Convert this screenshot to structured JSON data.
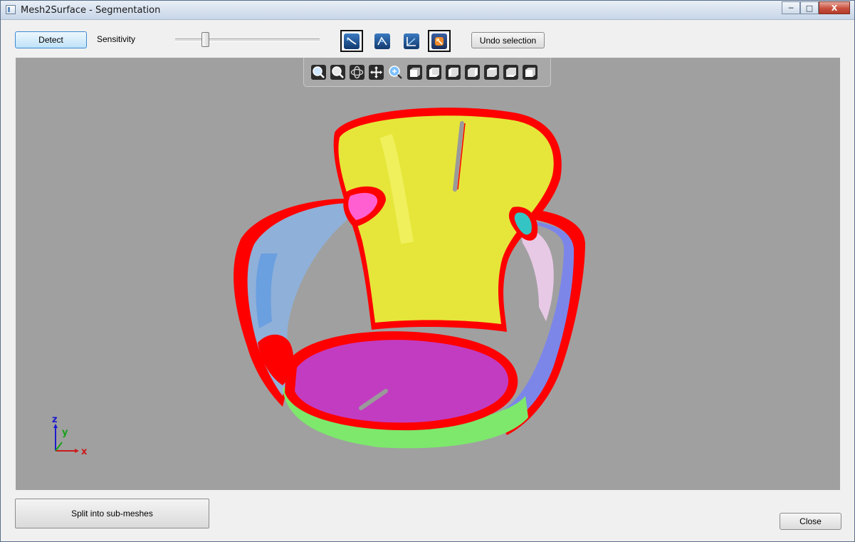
{
  "window": {
    "title": "Mesh2Surface - Segmentation",
    "controls": {
      "minimize": "─",
      "maximize": "□",
      "close": "X"
    }
  },
  "toolbar": {
    "detect_label": "Detect",
    "sensitivity_label": "Sensitivity",
    "sensitivity_level": 0.2,
    "undo_label": "Undo selection",
    "mode_buttons": [
      {
        "name": "select-region-tool",
        "active": true
      },
      {
        "name": "select-edge-tool",
        "active": false
      },
      {
        "name": "select-angle-tool",
        "active": false
      },
      {
        "name": "fill-region-tool",
        "active": true
      }
    ]
  },
  "view_toolbar": {
    "icons": [
      "zoom-fit-icon",
      "zoom-window-icon",
      "rotate-icon",
      "pan-icon",
      "zoom-icon",
      "view-front-icon",
      "view-back-icon",
      "view-left-icon",
      "view-right-icon",
      "view-top-icon",
      "view-bottom-icon",
      "view-iso-icon"
    ]
  },
  "viewport": {
    "background": "#a0a0a0",
    "axes": {
      "x": "x",
      "y": "y",
      "z": "z"
    },
    "segment_colors": {
      "boundary": "#ff0000",
      "cup": "#e6e63a",
      "base": "#c23cc2",
      "left_handle": "#8fb0d8",
      "right_handle": "#7c86e8",
      "rim": "#7de86c",
      "pink_patch": "#ff5fd0",
      "teal_patch": "#35c4c4"
    }
  },
  "footer": {
    "split_label": "Split into sub-meshes",
    "close_label": "Close"
  }
}
